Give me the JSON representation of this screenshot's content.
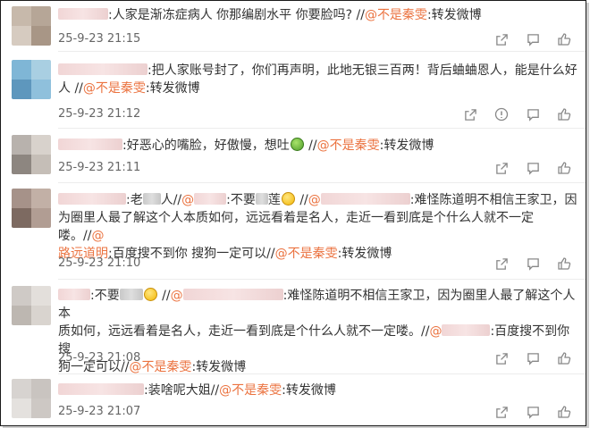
{
  "comments": [
    {
      "segments": [
        ":人家是渐冻症病人 你那编剧水平 你要脸吗? //",
        "@不是秦雯",
        ":转发微博"
      ],
      "time": "25-9-23 21:15",
      "actions": [
        "share-icon",
        "comment-icon",
        "like-icon"
      ]
    },
    {
      "segments": [
        ":把人家账号封了，你们再声明，此地无银三百两！背后蛐蛐恩人，能是什么好",
        "人 //",
        "@不是秦雯",
        ":转发微博"
      ],
      "time": "25-9-23 21:12",
      "actions": [
        "share-icon",
        "info-icon",
        "comment-icon",
        "like-icon"
      ]
    },
    {
      "segments": [
        ":好恶心的嘴脸，好傲慢，想吐",
        " //",
        "@不是秦雯",
        ":转发微博"
      ],
      "time": "25-9-23 21:11",
      "actions": [
        "share-icon",
        "comment-icon",
        "like-icon"
      ]
    },
    {
      "segments": [
        ":老",
        "人//",
        "@",
        ":不要",
        "莲",
        " //",
        "@",
        ":难怪陈道明不相信王家卫，因",
        "为圈里人最了解这个人本质如何，远远看着是名人，走近一看到底是个什么人就不一定喽。//",
        "@",
        "路远道明",
        ":百度搜不到你 搜狗一定可以//",
        "@不是秦雯",
        ":转发微博"
      ],
      "time": "25-9-23 21:10",
      "actions": [
        "share-icon",
        "comment-icon",
        "like-icon"
      ]
    },
    {
      "segments": [
        ":不要",
        " //",
        "@",
        ":难怪陈道明不相信王家卫，因为圈里人最了解这个人本",
        "质如何，远远看着是名人，走近一看到底是个什么人就不一定喽。//",
        "@",
        ":百度搜不到你 搜",
        "狗一定可以//",
        "@不是秦雯",
        ":转发微博"
      ],
      "time": "25-9-23 21:08",
      "actions": [
        "share-icon",
        "comment-icon",
        "like-icon"
      ]
    },
    {
      "segments": [
        ":装啥呢大姐//",
        "@不是秦雯",
        ":转发微博"
      ],
      "time": "25-9-23 21:07",
      "actions": [
        "share-icon",
        "comment-icon",
        "like-icon"
      ]
    }
  ],
  "colors": {
    "link": "#eb7340",
    "text": "#333333",
    "time": "#666666"
  }
}
